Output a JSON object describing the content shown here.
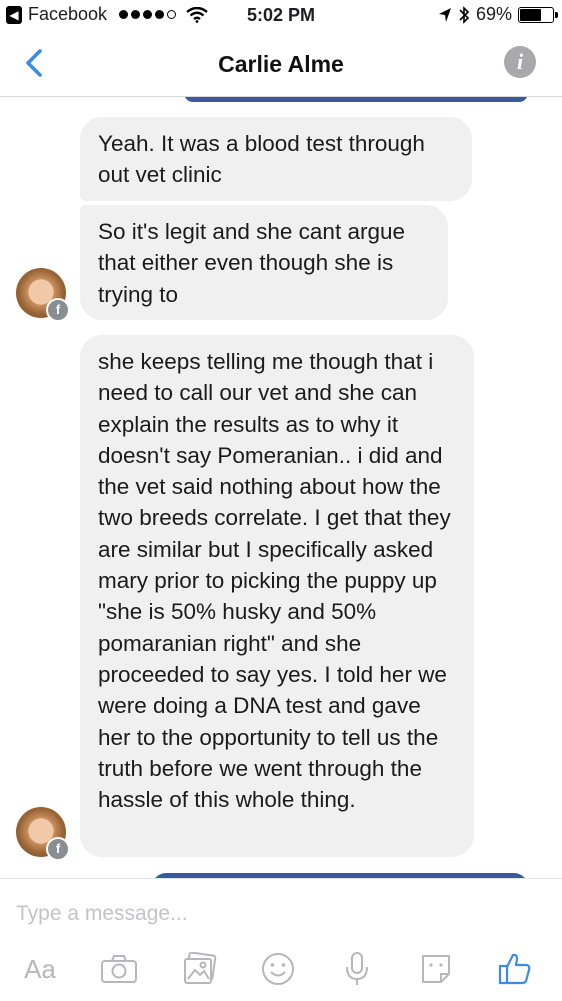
{
  "status_bar": {
    "back_app": "Facebook",
    "time": "5:02 PM",
    "battery_percent": "69%",
    "battery_level": 0.69
  },
  "header": {
    "contact_name": "Carlie Alme"
  },
  "conversation": {
    "messages": [
      {
        "sender": "Carlie Alme",
        "text": "Yeah. It was a blood test through out vet clinic"
      },
      {
        "sender": "Carlie Alme",
        "text": "So it's legit and she cant argue that either even though she is trying to"
      },
      {
        "sender": "Carlie Alme",
        "text": "she keeps telling me though that i need to call our vet and she can explain the results as to why it doesn't say Pomeranian.. i did and the vet said nothing about how the two breeds correlate. I get that they are similar but I specifically asked mary prior to picking the puppy up \"she is 50% husky and 50% pomaranian right\" and she proceeded to say yes. I told her we were doing a DNA test and gave her to the opportunity to tell us the truth before we went through the hassle of this whole thing."
      }
    ]
  },
  "composer": {
    "placeholder": "Type a message...",
    "text_format_label": "Aa"
  },
  "icons": {
    "back": "chevron-left-icon",
    "info": "info-icon",
    "camera": "camera-icon",
    "gallery": "photo-gallery-icon",
    "emoji": "smiley-icon",
    "mic": "microphone-icon",
    "sticker": "sticker-icon",
    "like": "thumbs-up-icon"
  },
  "colors": {
    "accent": "#3b8beb",
    "bubble_received": "#f1f0f0",
    "bubble_sent": "#3a5a9e",
    "icon_gray": "#b7b7bb"
  }
}
